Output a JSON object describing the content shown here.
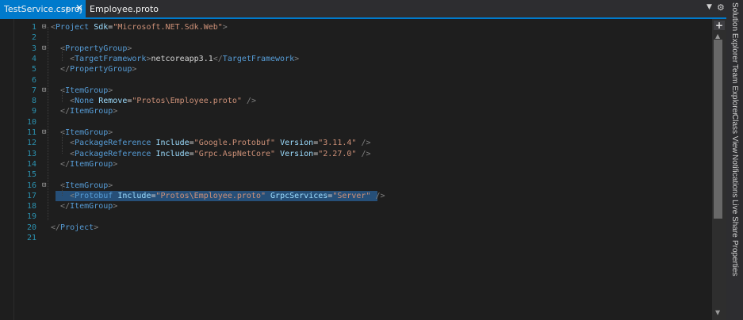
{
  "tabs": {
    "active": {
      "label": "TestService.csproj",
      "pin_icon": "pin-icon",
      "close_icon": "close-icon"
    },
    "inactive": {
      "label": "Employee.proto"
    }
  },
  "toolbar": {
    "dropdown_icon": "chevron-down-icon",
    "settings_icon": "gear-icon"
  },
  "side_tabs": [
    "Solution Explorer",
    "Team Explorer",
    "Class View",
    "Notifications",
    "Live Share",
    "Properties"
  ],
  "scrollbar": {
    "add_icon": "plus-icon"
  },
  "editor": {
    "selected_line": 17,
    "lines": [
      {
        "n": "1",
        "text": "<Project Sdk=\"Microsoft.NET.Sdk.Web\">"
      },
      {
        "n": "2",
        "text": ""
      },
      {
        "n": "3",
        "text": "  <PropertyGroup>"
      },
      {
        "n": "4",
        "text": "    <TargetFramework>netcoreapp3.1</TargetFramework>"
      },
      {
        "n": "5",
        "text": "  </PropertyGroup>"
      },
      {
        "n": "6",
        "text": ""
      },
      {
        "n": "7",
        "text": "  <ItemGroup>"
      },
      {
        "n": "8",
        "text": "    <None Remove=\"Protos\\Employee.proto\" />"
      },
      {
        "n": "9",
        "text": "  </ItemGroup>"
      },
      {
        "n": "10",
        "text": ""
      },
      {
        "n": "11",
        "text": "  <ItemGroup>"
      },
      {
        "n": "12",
        "text": "    <PackageReference Include=\"Google.Protobuf\" Version=\"3.11.4\" />"
      },
      {
        "n": "13",
        "text": "    <PackageReference Include=\"Grpc.AspNetCore\" Version=\"2.27.0\" />"
      },
      {
        "n": "14",
        "text": "  </ItemGroup>"
      },
      {
        "n": "15",
        "text": ""
      },
      {
        "n": "16",
        "text": "  <ItemGroup>"
      },
      {
        "n": "17",
        "text": "    <Protobuf Include=\"Protos\\Employee.proto\" GrpcServices=\"Server\" />"
      },
      {
        "n": "18",
        "text": "  </ItemGroup>"
      },
      {
        "n": "19",
        "text": ""
      },
      {
        "n": "20",
        "text": "</Project>"
      },
      {
        "n": "21",
        "text": ""
      }
    ]
  }
}
